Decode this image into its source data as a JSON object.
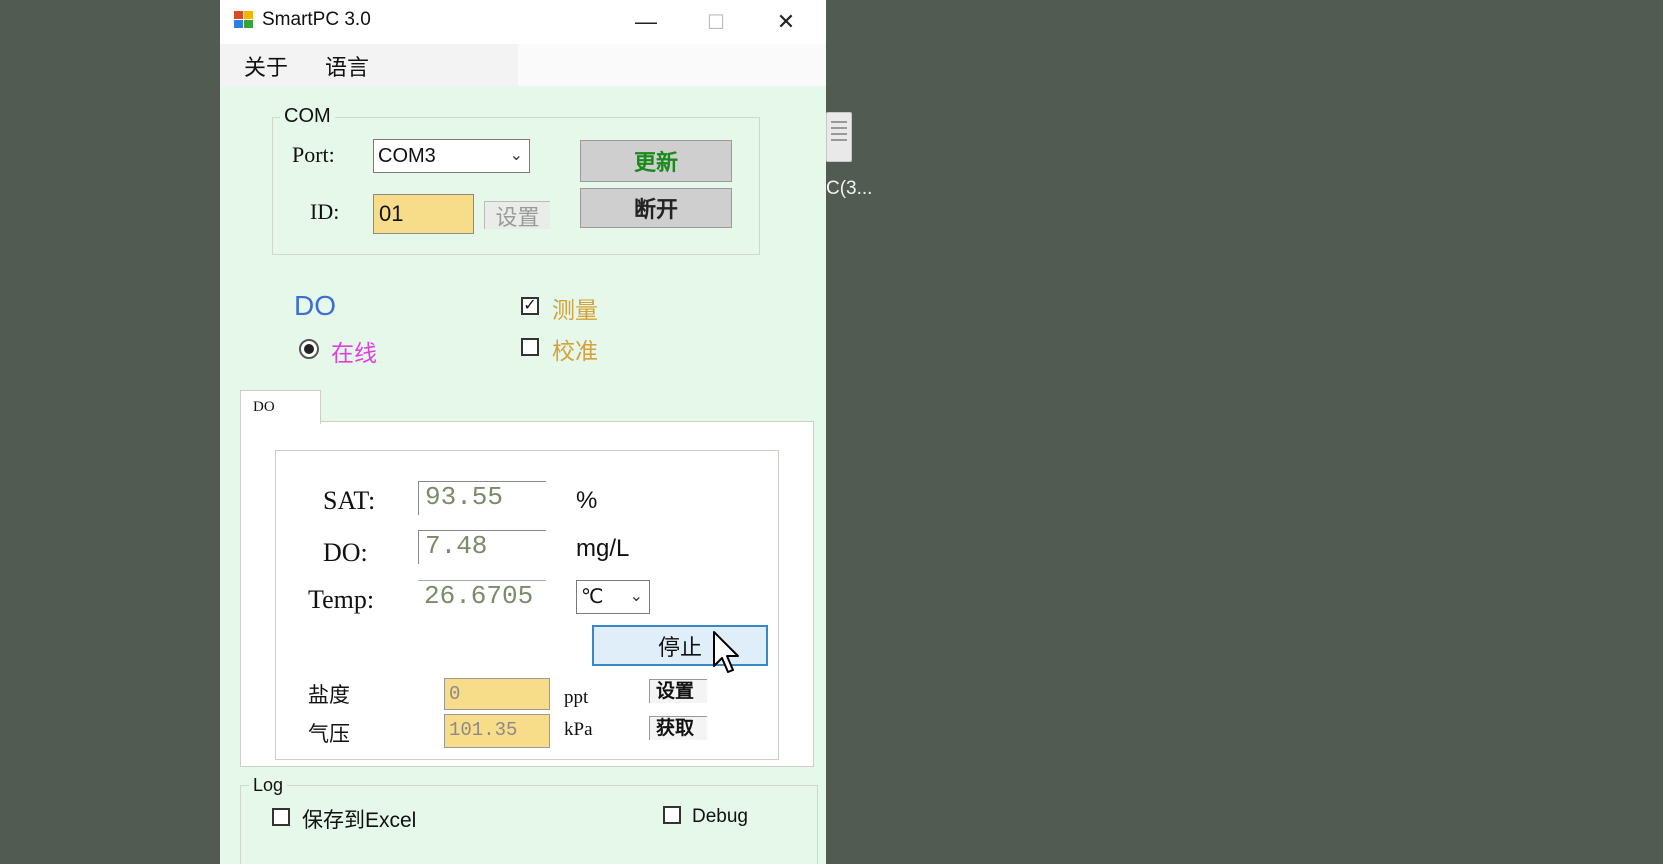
{
  "desktop": {
    "icon_label": "C(3..."
  },
  "window": {
    "title": "SmartPC 3.0",
    "icon": "app-grid-icon",
    "controls": {
      "minimize": "—",
      "maximize": "☐",
      "close": "✕"
    }
  },
  "menu": {
    "items": [
      "关于",
      "语言"
    ]
  },
  "com": {
    "legend": "COM",
    "port_label": "Port:",
    "port_value": "COM3",
    "id_label": "ID:",
    "id_value": "01",
    "set_label": "设置",
    "refresh_label": "更新",
    "disconnect_label": "断开"
  },
  "mode": {
    "sensor": "DO",
    "online_label": "在线",
    "online_selected": true,
    "measure_label": "测量",
    "measure_checked": true,
    "calibrate_label": "校准",
    "calibrate_checked": false
  },
  "tabs": [
    {
      "label": "DO",
      "active": true
    }
  ],
  "readings": {
    "sat_label": "SAT:",
    "sat_value": "93.55",
    "sat_unit": "%",
    "do_label": "DO:",
    "do_value": "7.48",
    "do_unit": "mg/L",
    "temp_label": "Temp:",
    "temp_value": "26.6705",
    "temp_unit": "℃",
    "stop_label": "停止"
  },
  "params": {
    "salinity_label": "盐度",
    "salinity_value": "0",
    "salinity_unit": "ppt",
    "salinity_btn": "设置",
    "pressure_label": "气压",
    "pressure_value": "101.35",
    "pressure_unit": "kPa",
    "pressure_btn": "获取"
  },
  "log": {
    "legend": "Log",
    "save_excel_label": "保存到Excel",
    "save_excel_checked": false,
    "debug_label": "Debug",
    "debug_checked": false
  },
  "colors": {
    "desktop_bg": "#515b51",
    "window_bg": "#e6f8ea",
    "sensor_blue": "#3b6fd4",
    "online_magenta": "#e040e0",
    "option_orange": "#d4a13a",
    "refresh_green": "#1a8a1a",
    "input_yellow": "#f7dd8a",
    "readout_gray": "#7a8b6a",
    "stop_border": "#3a87c8"
  }
}
